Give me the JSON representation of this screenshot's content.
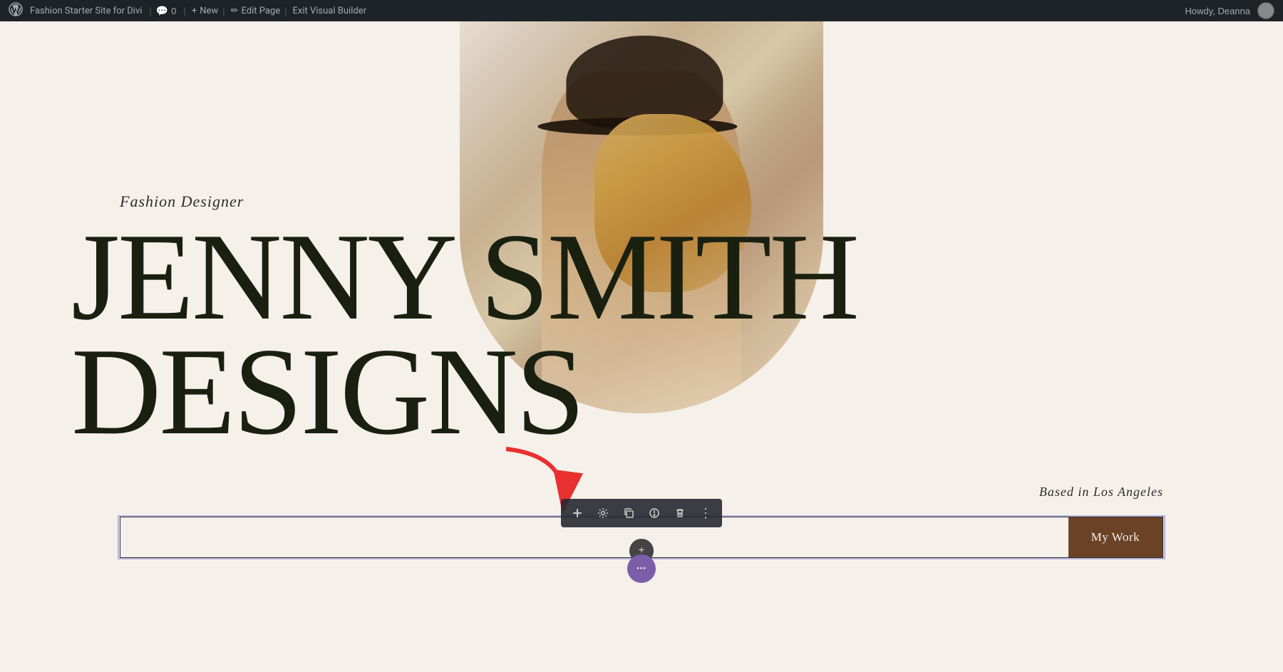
{
  "adminBar": {
    "wpLogo": "⊕",
    "siteName": "Fashion Starter Site for Divi",
    "commentsIcon": "💬",
    "commentsCount": "0",
    "newIcon": "+",
    "newLabel": "New",
    "editIcon": "✏",
    "editLabel": "Edit Page",
    "exitLabel": "Exit Visual Builder",
    "howdyLabel": "Howdy, Deanna"
  },
  "hero": {
    "subtitleLabel": "Fashion Designer",
    "nameLine1": "JENNY SMITH",
    "nameLine2": "DESIGNS",
    "basedLabel": "Based in Los Angeles"
  },
  "bottomRow": {
    "inputPlaceholder": "",
    "buttonLabel": "My Work"
  },
  "diviToolbar": {
    "addIcon": "+",
    "settingsIcon": "⚙",
    "duplicateIcon": "⧉",
    "disableIcon": "⏻",
    "deleteIcon": "🗑",
    "moreIcon": "⋮"
  },
  "addSectionButton": {
    "label": "+"
  },
  "threeDotsButton": {
    "label": "•••"
  }
}
